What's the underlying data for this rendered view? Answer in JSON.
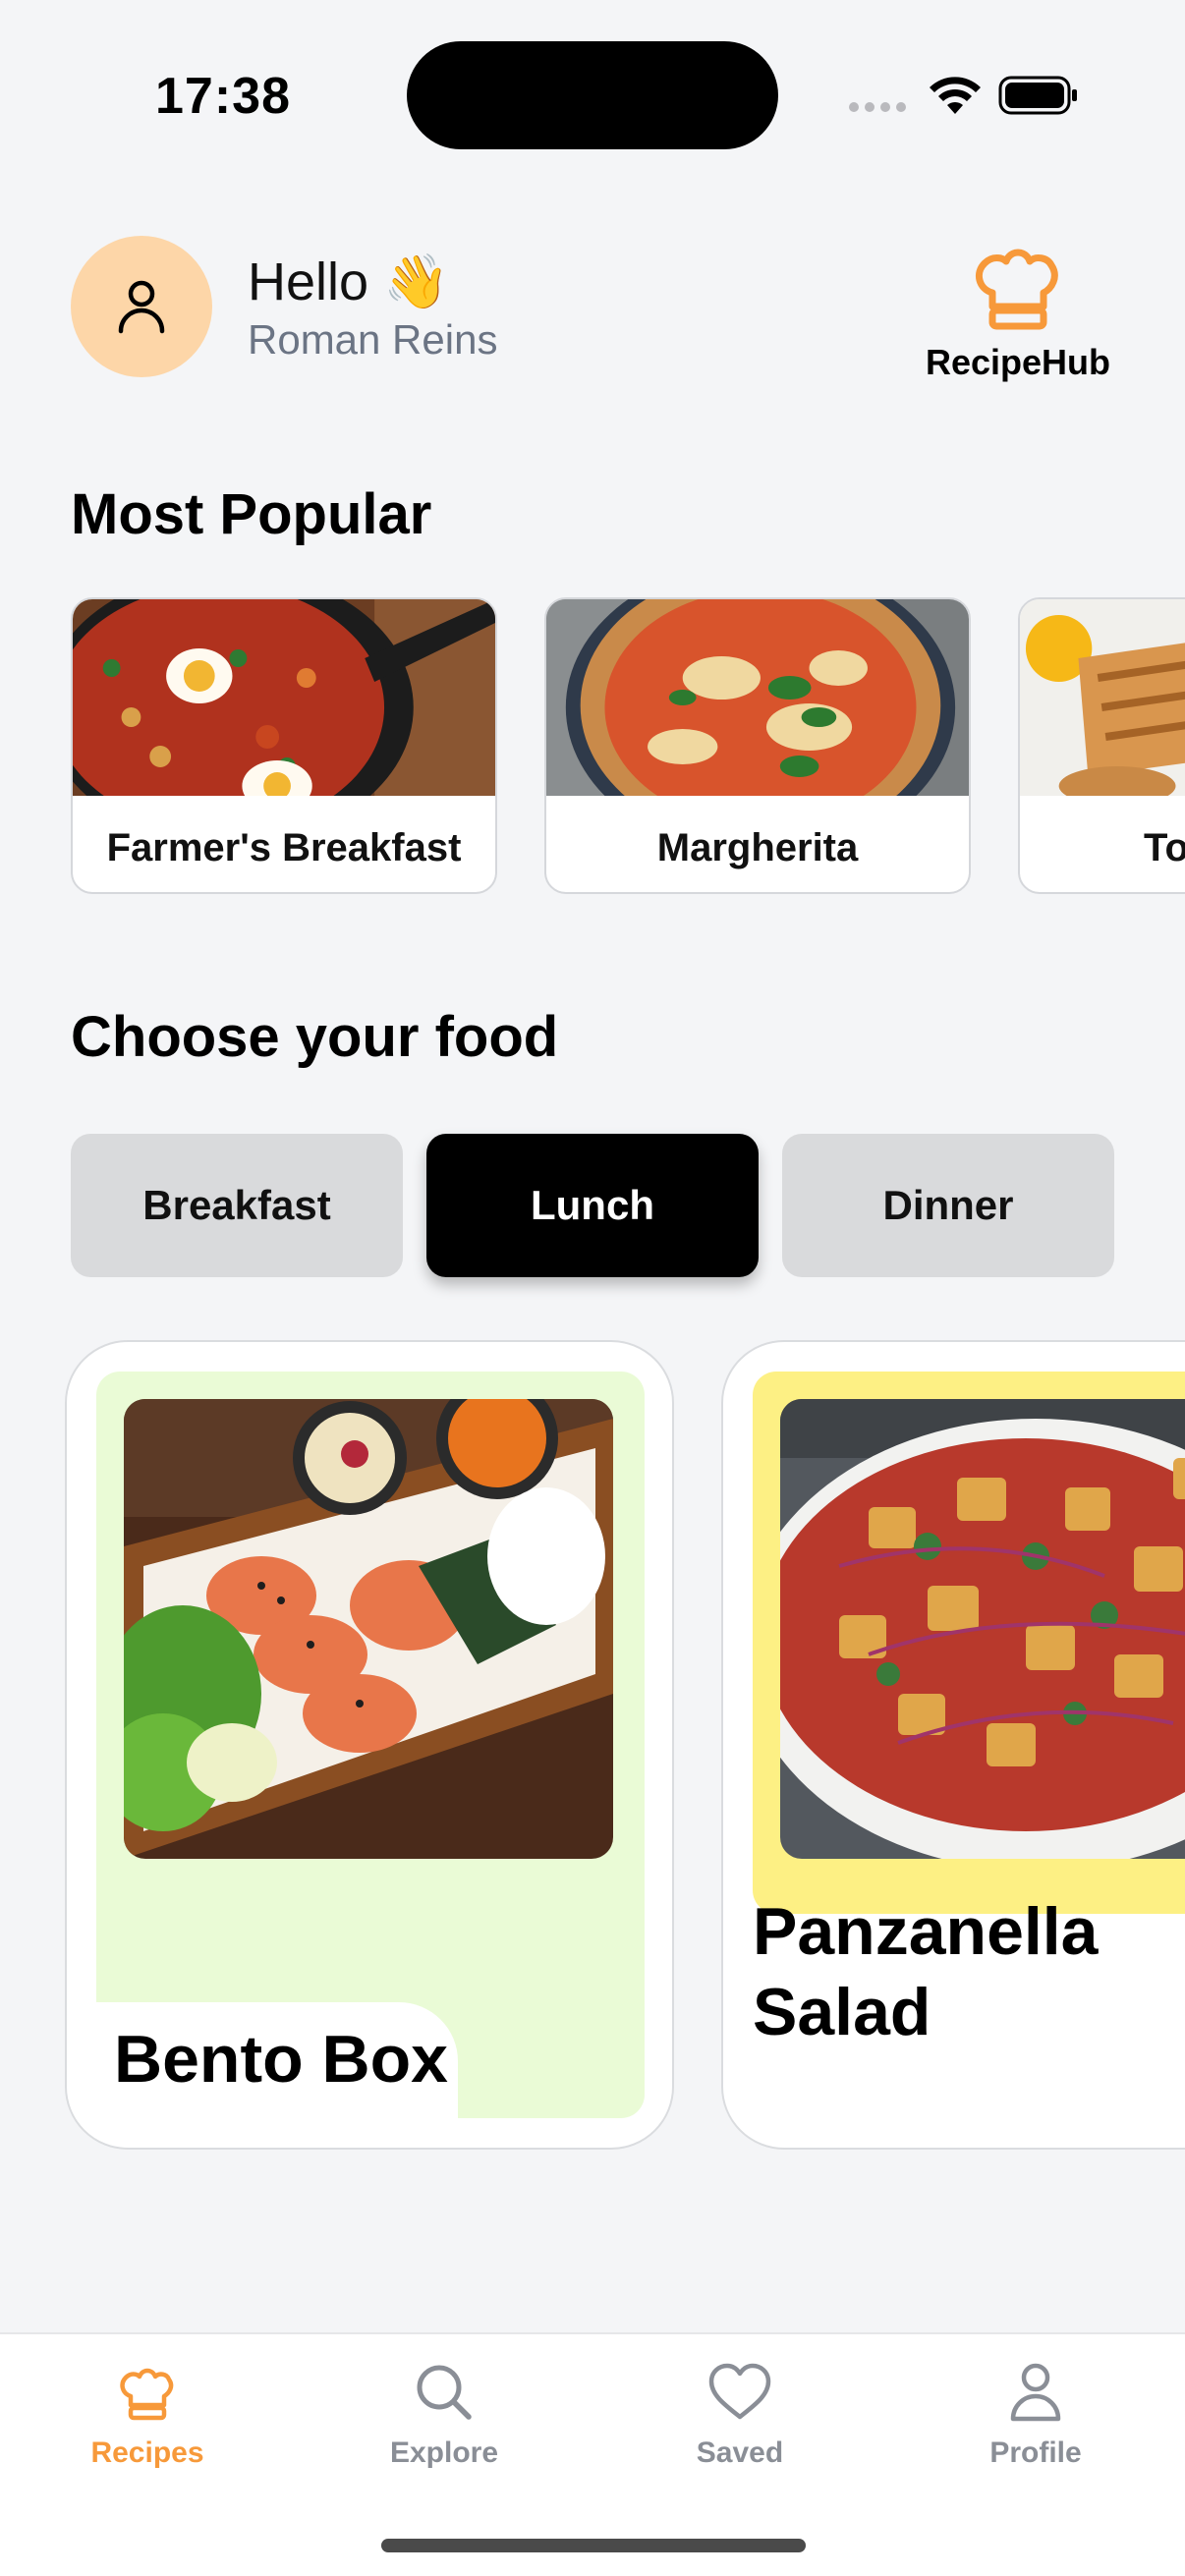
{
  "status_bar": {
    "time": "17:38"
  },
  "header": {
    "greeting": "Hello 👋",
    "user_name": "Roman Reins",
    "brand_name": "RecipeHub"
  },
  "popular": {
    "title": "Most Popular",
    "items": [
      {
        "label": "Farmer's Breakfast"
      },
      {
        "label": "Margherita"
      },
      {
        "label": "To"
      }
    ]
  },
  "choose": {
    "title": "Choose your food",
    "tabs": [
      {
        "label": "Breakfast",
        "active": false
      },
      {
        "label": "Lunch",
        "active": true
      },
      {
        "label": "Dinner",
        "active": false
      }
    ]
  },
  "foods": [
    {
      "name": "Bento Box",
      "panel_color": "#eafbd6"
    },
    {
      "name_line1": "Panzanella",
      "name_line2": "Salad",
      "panel_color": "#fdf084"
    }
  ],
  "nav": {
    "items": [
      {
        "label": "Recipes",
        "icon": "chef-hat-icon",
        "active": true
      },
      {
        "label": "Explore",
        "icon": "search-icon",
        "active": false
      },
      {
        "label": "Saved",
        "icon": "heart-icon",
        "active": false
      },
      {
        "label": "Profile",
        "icon": "person-icon",
        "active": false
      }
    ]
  },
  "colors": {
    "accent": "#f7993a",
    "avatar_bg": "#fdd6a8",
    "tab_inactive": "#d9dadc",
    "tab_active": "#000000",
    "background": "#f4f5f7"
  }
}
